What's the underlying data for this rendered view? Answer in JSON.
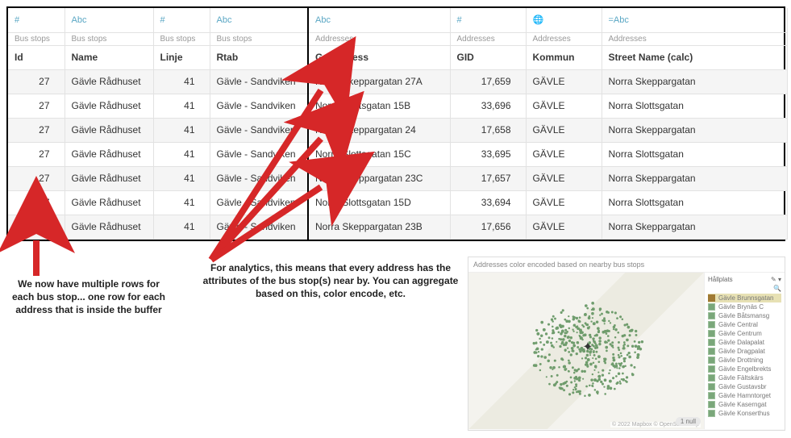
{
  "columns": [
    {
      "type_icon": "#",
      "type_label": "#",
      "source": "Bus stops",
      "name": "Id",
      "kind": "num"
    },
    {
      "type_icon": "Abc",
      "type_label": "Abc",
      "source": "Bus stops",
      "name": "Name",
      "kind": "txt"
    },
    {
      "type_icon": "#",
      "type_label": "#",
      "source": "Bus stops",
      "name": "Linje",
      "kind": "num"
    },
    {
      "type_icon": "Abc",
      "type_label": "Abc",
      "source": "Bus stops",
      "name": "Rtab",
      "kind": "txt"
    },
    {
      "type_icon": "Abc",
      "type_label": "Abc",
      "source": "Addresses",
      "name": "Gatuadress",
      "kind": "txt"
    },
    {
      "type_icon": "#",
      "type_label": "#",
      "source": "Addresses",
      "name": "GID",
      "kind": "num"
    },
    {
      "type_icon": "🌐",
      "type_label": "globe",
      "source": "Addresses",
      "name": "Kommun",
      "kind": "txt"
    },
    {
      "type_icon": "=Abc",
      "type_label": "=Abc",
      "source": "Addresses",
      "name": "Street Name (calc)",
      "kind": "txt"
    }
  ],
  "rows": [
    [
      "27",
      "Gävle Rådhuset",
      "41",
      "Gävle - Sandviken",
      "Norra Skeppargatan 27A",
      "17,659",
      "GÄVLE",
      "Norra Skeppargatan"
    ],
    [
      "27",
      "Gävle Rådhuset",
      "41",
      "Gävle - Sandviken",
      "Norra Slottsgatan 15B",
      "33,696",
      "GÄVLE",
      "Norra Slottsgatan"
    ],
    [
      "27",
      "Gävle Rådhuset",
      "41",
      "Gävle - Sandviken",
      "Norra Skeppargatan 24",
      "17,658",
      "GÄVLE",
      "Norra Skeppargatan"
    ],
    [
      "27",
      "Gävle Rådhuset",
      "41",
      "Gävle - Sandviken",
      "Norra Slottsgatan 15C",
      "33,695",
      "GÄVLE",
      "Norra Slottsgatan"
    ],
    [
      "27",
      "Gävle Rådhuset",
      "41",
      "Gävle - Sandviken",
      "Norra Skeppargatan 23C",
      "17,657",
      "GÄVLE",
      "Norra Skeppargatan"
    ],
    [
      "27",
      "Gävle Rådhuset",
      "41",
      "Gävle - Sandviken",
      "Norra Slottsgatan 15D",
      "33,694",
      "GÄVLE",
      "Norra Slottsgatan"
    ],
    [
      "27",
      "Gävle Rådhuset",
      "41",
      "Gävle - Sandviken",
      "Norra Skeppargatan 23B",
      "17,656",
      "GÄVLE",
      "Norra Skeppargatan"
    ]
  ],
  "annot1": "We now have multiple rows for each bus stop... one row for each address that is inside the buffer",
  "annot2": "For analytics, this means that every address has the attributes of the bus stop(s) near by.  You can aggregate based on this, color encode, etc.",
  "map": {
    "title": "Addresses color encoded based on nearby bus stops",
    "legend_header": "Hållplats",
    "legend_search_icon": "🔍",
    "highlight_item": "Gävle Brunnsgatan",
    "items": [
      "Gävle Brynäs C",
      "Gävle Båtsmansg",
      "Gävle Central",
      "Gävle Centrum",
      "Gävle Dalapalat",
      "Gävle Dragpalat",
      "Gävle Drottning",
      "Gävle Engelbrekts",
      "Gävle Fältskärs",
      "Gävle Gustavsbr",
      "Gävle Hamntorget",
      "Gävle Kaserngat",
      "Gävle Konserthus"
    ],
    "attribution": "© 2022 Mapbox © OpenStreetMap",
    "null_label": "1 null"
  }
}
